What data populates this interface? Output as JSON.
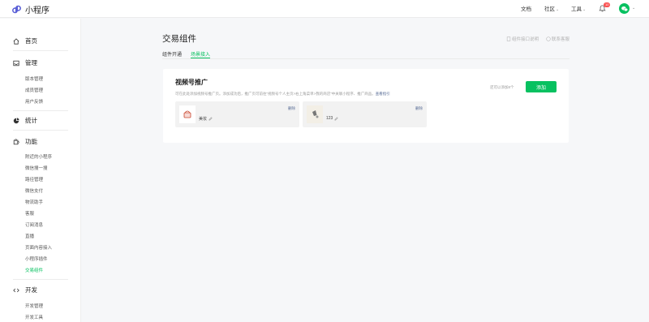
{
  "app": {
    "name": "小程序"
  },
  "topnav": {
    "docs": "文档",
    "community": "社区",
    "tools": "工具",
    "badge_count": "10"
  },
  "sidebar": {
    "home": "首页",
    "manage": {
      "label": "管理",
      "items": [
        "版本管理",
        "成员管理",
        "用户反馈"
      ]
    },
    "stats": "统计",
    "features": {
      "label": "功能",
      "items": [
        "附近的小程序",
        "微信搜一搜",
        "路径管理",
        "微信支付",
        "物流助手",
        "客服",
        "订阅消息",
        "直播",
        "页面内容接入",
        "小程序插件",
        "交易组件"
      ]
    },
    "dev": {
      "label": "开发",
      "items": [
        "开发管理",
        "开发工具"
      ]
    }
  },
  "main": {
    "title": "交易组件",
    "doc_link_1": "组件接口说明",
    "doc_link_2": "联系客服",
    "tabs": [
      "组件开通",
      "场景接入"
    ],
    "panel": {
      "title": "视频号推广",
      "desc": "可在此处添加视频号推广页。添加成功后，推广页可前往“视频号个人主页>右上角菜单>我的商店”中关联小程序、推广商品。",
      "desc_link": "查看指引",
      "remain": "还可以添加8个",
      "add_button": "添加",
      "cards": [
        {
          "name": "美妆",
          "delete": "删除"
        },
        {
          "name": "123",
          "delete": "删除"
        }
      ]
    }
  },
  "colors": {
    "accent": "#07c160",
    "link": "#576b95"
  }
}
